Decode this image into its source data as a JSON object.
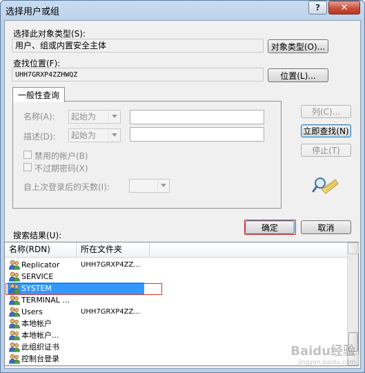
{
  "window": {
    "title": "选择用户或组",
    "help_label": "?",
    "close_label": "✕"
  },
  "object_types": {
    "label": "选择此对象类型(S):",
    "value": "用户、组或内置安全主体",
    "button": "对象类型(O)..."
  },
  "location": {
    "label": "查找位置(F):",
    "value": "UHH7GRXP4ZZHWQZ",
    "button": "位置(L)..."
  },
  "tab": {
    "label": "一般性查询"
  },
  "query": {
    "name_label": "名称(A):",
    "name_mode": "起始为",
    "desc_label": "描述(D):",
    "desc_mode": "起始为",
    "disabled_accounts": "禁用的帐户(B)",
    "non_expiring_pwd": "不过期密码(X)",
    "days_label": "自上次登录后的天数(I):"
  },
  "side_buttons": {
    "columns": "列(C)...",
    "find_now": "立即查找(N)",
    "stop": "停止(T)"
  },
  "footer": {
    "ok": "确定",
    "cancel": "取消"
  },
  "results": {
    "label": "搜索结果(U):",
    "columns": [
      "名称(RDN)",
      "所在文件夹"
    ],
    "rows": [
      {
        "name": "Replicator",
        "folder": "UHH7GRXP4ZZ...",
        "icon": "group-icon"
      },
      {
        "name": "SERVICE",
        "folder": "",
        "icon": "group-icon"
      },
      {
        "name": "SYSTEM",
        "folder": "",
        "icon": "group-icon",
        "selected": true
      },
      {
        "name": "TERMINAL ...",
        "folder": "",
        "icon": "group-icon"
      },
      {
        "name": "Users",
        "folder": "UHH7GRXP4ZZ...",
        "icon": "group-icon"
      },
      {
        "name": "本地帐户",
        "folder": "",
        "icon": "group-icon"
      },
      {
        "name": "本地帐户...",
        "folder": "",
        "icon": "group-icon"
      },
      {
        "name": "此组织证书",
        "folder": "",
        "icon": "group-icon"
      },
      {
        "name": "控制台登录",
        "folder": "",
        "icon": "group-icon"
      }
    ]
  },
  "watermark": {
    "brand": "Baidu经验",
    "url": "jingyan.baidu.com"
  },
  "colors": {
    "selection": "#3399ff",
    "highlight_outline": "#e0302b",
    "title_bar": "#bcd2ea"
  }
}
